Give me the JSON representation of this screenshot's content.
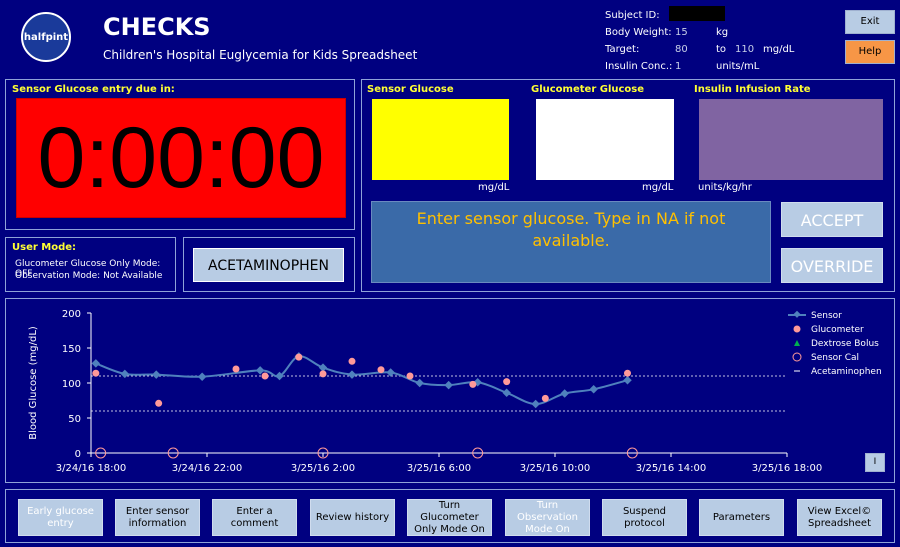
{
  "header": {
    "logo_text": "halfpint",
    "title": "CHECKS",
    "subtitle": "Children's Hospital Euglycemia for Kids Spreadsheet",
    "subject_id_label": "Subject ID:",
    "body_weight_label": "Body Weight:",
    "body_weight_value": "15",
    "body_weight_unit": "kg",
    "target_label": "Target:",
    "target_low": "80",
    "target_to": "to",
    "target_high": "110",
    "target_unit": "mg/dL",
    "insulin_conc_label": "Insulin Conc.:",
    "insulin_conc_value": "1",
    "insulin_conc_unit": "units/mL",
    "exit_label": "Exit",
    "help_label": "Help"
  },
  "timer": {
    "label": "Sensor Glucose entry due in:",
    "value": "0:00:00"
  },
  "user_mode": {
    "label": "User Mode:",
    "line1": "Glucometer Glucose Only Mode: OFF",
    "line2": "Observation Mode: Not Available",
    "acetaminophen_label": "ACETAMINOPHEN"
  },
  "entries": {
    "sensor_label": "Sensor Glucose",
    "sensor_unit": "mg/dL",
    "glucometer_label": "Glucometer Glucose",
    "glucometer_unit": "mg/dL",
    "insulin_label": "Insulin Infusion Rate",
    "insulin_unit": "units/kg/hr",
    "prompt": "Enter sensor glucose. Type in NA if not available.",
    "accept_label": "ACCEPT",
    "override_label": "OVERRIDE"
  },
  "colors": {
    "background": "#000080",
    "timer": "#ff0000",
    "sensor_box": "#ffff00",
    "glucometer_box": "#ffffff",
    "insulin_box": "#8064a2",
    "sensor_line": "#4f81bd",
    "glucometer_point": "#ff9999",
    "prompt_text": "#ffc000"
  },
  "chart_data": {
    "type": "line",
    "ylabel": "Blood  Glucose   (mg/dL)",
    "ylim": [
      0,
      200
    ],
    "yticks": [
      "0",
      "50",
      "100",
      "150",
      "200"
    ],
    "xlim": [
      "3/24/16 18:00",
      "3/25/16 18:00"
    ],
    "xticks": [
      "3/24/16 18:00",
      "3/24/16 22:00",
      "3/25/16 2:00",
      "3/25/16 6:00",
      "3/25/16 10:00",
      "3/25/16 14:00",
      "3/25/16 18:00"
    ],
    "target_lines": [
      60,
      110
    ],
    "series": [
      {
        "name": "Sensor",
        "x": [
          "3/24/16 18:10",
          "3/24/16 19:10",
          "3/24/16 20:15",
          "3/24/16 21:50",
          "3/24/16 23:50",
          "3/25/16 0:30",
          "3/25/16 1:10",
          "3/25/16 2:00",
          "3/25/16 3:00",
          "3/25/16 4:20",
          "3/25/16 5:20",
          "3/25/16 6:20",
          "3/25/16 7:20",
          "3/25/16 8:20",
          "3/25/16 9:20",
          "3/25/16 10:20",
          "3/25/16 11:20",
          "3/25/16 12:30"
        ],
        "values": [
          128,
          113,
          112,
          109,
          118,
          110,
          138,
          122,
          112,
          115,
          100,
          97,
          101,
          86,
          70,
          85,
          91,
          104
        ]
      },
      {
        "name": "Glucometer",
        "x": [
          "3/24/16 18:10",
          "3/24/16 20:20",
          "3/24/16 23:00",
          "3/25/16 0:00",
          "3/25/16 1:10",
          "3/25/16 2:00",
          "3/25/16 3:00",
          "3/25/16 4:00",
          "3/25/16 5:00",
          "3/25/16 7:10",
          "3/25/16 8:20",
          "3/25/16 9:40",
          "3/25/16 12:30"
        ],
        "values": [
          114,
          71,
          120,
          110,
          137,
          113,
          131,
          119,
          110,
          98,
          102,
          78,
          114
        ]
      },
      {
        "name": "Dextrose Bolus",
        "x": [],
        "values": []
      },
      {
        "name": "Sensor Cal",
        "x": [
          "3/24/16 18:20",
          "3/24/16 20:50",
          "3/25/16 2:00",
          "3/25/16 7:20",
          "3/25/16 12:40"
        ],
        "values": [
          0,
          0,
          0,
          0,
          0
        ]
      },
      {
        "name": "Acetaminophen",
        "x": [],
        "values": []
      }
    ],
    "legend": "top-right",
    "info_button": "I"
  },
  "bottom_buttons": [
    {
      "label": "Early glucose entry",
      "enabled": false
    },
    {
      "label": "Enter sensor information",
      "enabled": true
    },
    {
      "label": "Enter a comment",
      "enabled": true
    },
    {
      "label": "Review history",
      "enabled": true
    },
    {
      "label": "Turn Glucometer Only Mode On",
      "enabled": true
    },
    {
      "label": "Turn Observation Mode On",
      "enabled": false
    },
    {
      "label": "Suspend protocol",
      "enabled": true
    },
    {
      "label": "Parameters",
      "enabled": true
    },
    {
      "label": "View Excel© Spreadsheet",
      "enabled": true
    }
  ]
}
